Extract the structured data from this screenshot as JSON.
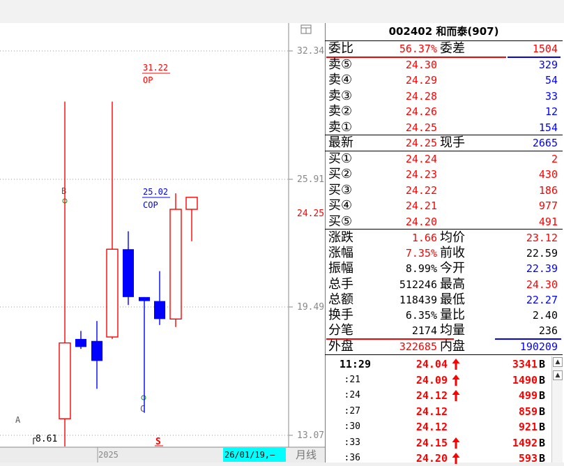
{
  "chart": {
    "y_axis_labels": [
      "32.34",
      "25.91",
      "19.49",
      "13.07"
    ],
    "current_price_label": "24.25",
    "annotation_op_value": "31.22",
    "annotation_op_label": "OP",
    "annotation_cop_value": "25.02",
    "annotation_cop_label": "COP",
    "wave_point_a": "A",
    "wave_point_b": "B",
    "wave_point_c": "C",
    "low_marker": "8.61",
    "signal_marker": "S",
    "date_axis_year": "2025",
    "cursor_date": "26/01/19,—",
    "period_label": "月线",
    "candles": [
      {
        "open": 13.9,
        "close": 17.7,
        "high": 29.8,
        "low": 8.6
      },
      {
        "open": 17.9,
        "close": 17.5,
        "high": 18.3,
        "low": 17.4
      },
      {
        "open": 17.8,
        "close": 16.8,
        "high": 18.8,
        "low": 15.4
      },
      {
        "open": 18.0,
        "close": 22.4,
        "high": 29.8,
        "low": 17.9
      },
      {
        "open": 22.4,
        "close": 20.0,
        "high": 23.3,
        "low": 19.6
      },
      {
        "open": 20.0,
        "close": 19.8,
        "high": 20.0,
        "low": 14.2
      },
      {
        "open": 19.8,
        "close": 18.9,
        "high": 21.3,
        "low": 18.6
      },
      {
        "open": 18.9,
        "close": 24.4,
        "high": 25.2,
        "low": 18.5
      },
      {
        "open": 24.4,
        "close": 25.0,
        "high": 25.0,
        "low": 22.8
      }
    ],
    "colors": {
      "up": "#ff0000",
      "down": "#0000ff"
    }
  },
  "panel": {
    "title": "002402 和而泰(907)",
    "weibi_label": "委比",
    "weibi_value": "56.37%",
    "weicha_label": "委差",
    "weicha_value": "1504",
    "asks": [
      {
        "label": "卖⑤",
        "price": "24.30",
        "volume": "329"
      },
      {
        "label": "卖④",
        "price": "24.29",
        "volume": "54"
      },
      {
        "label": "卖③",
        "price": "24.28",
        "volume": "33"
      },
      {
        "label": "卖②",
        "price": "24.26",
        "volume": "12"
      },
      {
        "label": "卖①",
        "price": "24.25",
        "volume": "154"
      }
    ],
    "latest_label": "最新",
    "latest_value": "24.25",
    "xianshou_label": "现手",
    "xianshou_value": "2665",
    "bids": [
      {
        "label": "买①",
        "price": "24.24",
        "volume": "2"
      },
      {
        "label": "买②",
        "price": "24.23",
        "volume": "430"
      },
      {
        "label": "买③",
        "price": "24.22",
        "volume": "186"
      },
      {
        "label": "买④",
        "price": "24.21",
        "volume": "977"
      },
      {
        "label": "买⑤",
        "price": "24.20",
        "volume": "491"
      }
    ],
    "stats": [
      {
        "l1": "涨跌",
        "v1": "1.66",
        "c1": "red",
        "l2": "均价",
        "v2": "23.12",
        "c2": "red"
      },
      {
        "l1": "涨幅",
        "v1": "7.35%",
        "c1": "red",
        "l2": "前收",
        "v2": "22.59",
        "c2": "black"
      },
      {
        "l1": "振幅",
        "v1": "8.99%",
        "c1": "black",
        "l2": "今开",
        "v2": "22.39",
        "c2": "blue"
      },
      {
        "l1": "总手",
        "v1": "512246",
        "c1": "black",
        "l2": "最高",
        "v2": "24.30",
        "c2": "red"
      },
      {
        "l1": "总额",
        "v1": "118439",
        "c1": "black",
        "l2": "最低",
        "v2": "22.27",
        "c2": "blue"
      },
      {
        "l1": "换手",
        "v1": "6.35%",
        "c1": "black",
        "l2": "量比",
        "v2": "2.40",
        "c2": "black"
      },
      {
        "l1": "分笔",
        "v1": "2174",
        "c1": "black",
        "l2": "均量",
        "v2": "236",
        "c2": "black"
      }
    ],
    "waipan_label": "外盘",
    "waipan_value": "322685",
    "neipan_label": "内盘",
    "neipan_value": "190209",
    "ticks": [
      {
        "time": "11:29",
        "price": "24.04",
        "up": true,
        "volume": "3341",
        "bs": "B"
      },
      {
        "time": ":21",
        "price": "24.09",
        "up": true,
        "volume": "1490",
        "bs": "B"
      },
      {
        "time": ":24",
        "price": "24.12",
        "up": true,
        "volume": "499",
        "bs": "B"
      },
      {
        "time": ":27",
        "price": "24.12",
        "up": false,
        "volume": "859",
        "bs": "B"
      },
      {
        "time": ":30",
        "price": "24.12",
        "up": false,
        "volume": "921",
        "bs": "B"
      },
      {
        "time": ":33",
        "price": "24.15",
        "up": true,
        "volume": "1492",
        "bs": "B"
      },
      {
        "time": ":36",
        "price": "24.20",
        "up": true,
        "volume": "593",
        "bs": "B"
      }
    ],
    "colors": {
      "red": "#ff0000",
      "blue": "#0000ff"
    }
  }
}
